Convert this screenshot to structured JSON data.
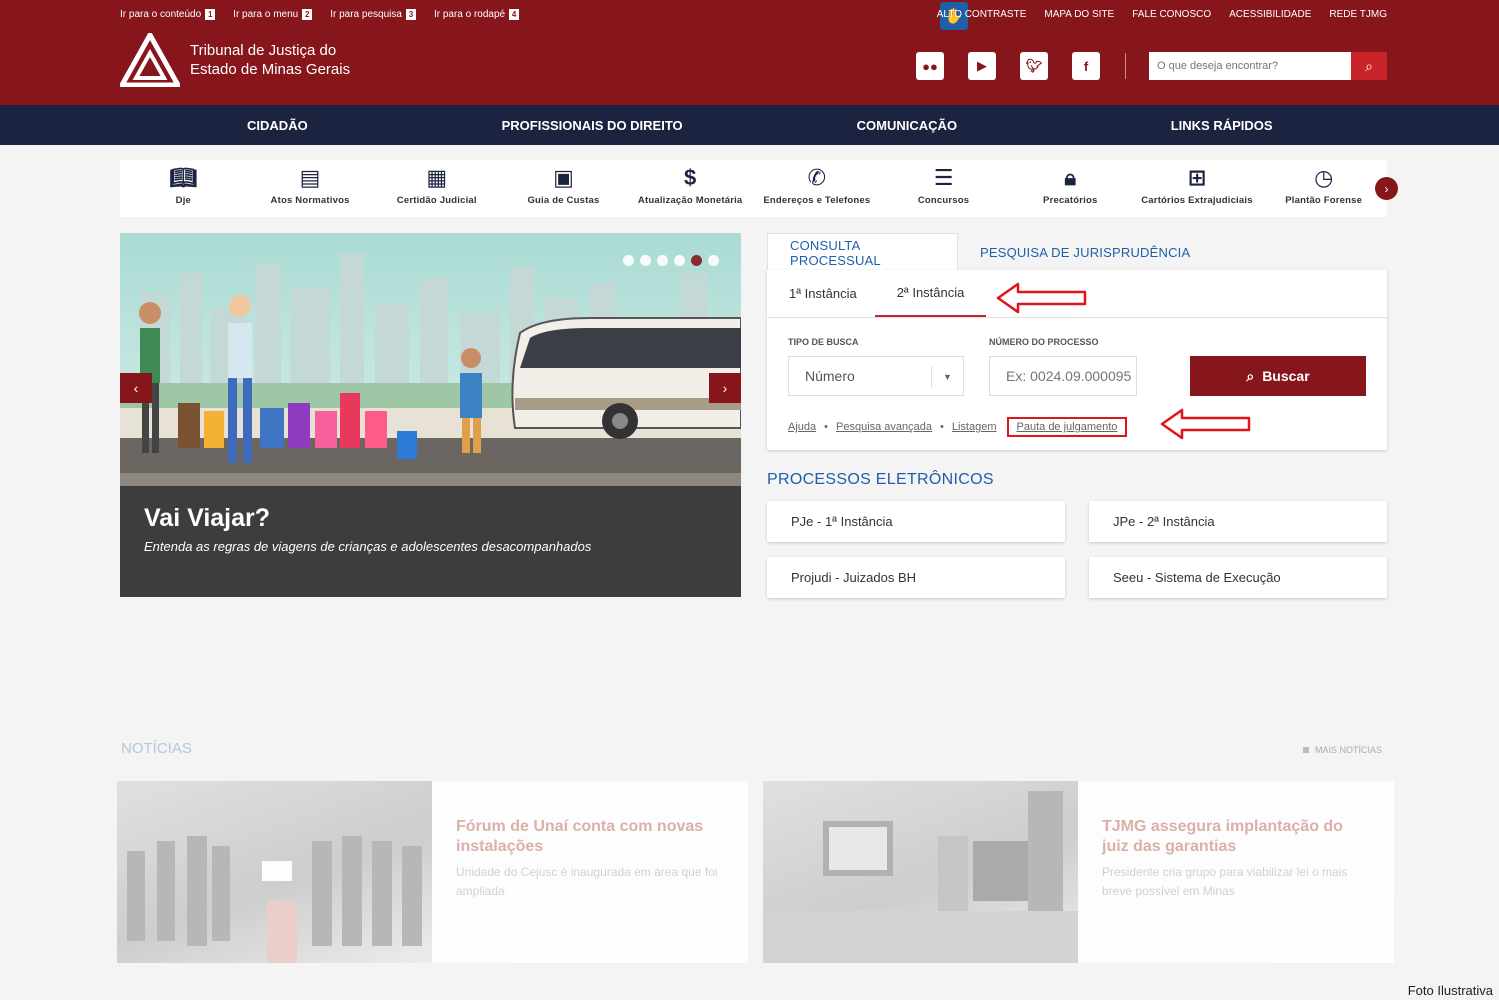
{
  "skip_links": [
    {
      "label": "Ir para o conteúdo",
      "key": "1"
    },
    {
      "label": "Ir para o menu",
      "key": "2"
    },
    {
      "label": "Ir para pesquisa",
      "key": "3"
    },
    {
      "label": "Ir para o rodapé",
      "key": "4"
    }
  ],
  "util_links": [
    "ALTO CONTRASTE",
    "MAPA DO SITE",
    "FALE CONOSCO",
    "ACESSIBILIDADE",
    "REDE TJMG"
  ],
  "logo": {
    "line1": "Tribunal de Justiça do",
    "line2": "Estado de Minas Gerais"
  },
  "social": [
    "flickr-icon",
    "youtube-icon",
    "twitter-icon",
    "facebook-icon"
  ],
  "search": {
    "placeholder": "O que deseja encontrar?"
  },
  "nav": [
    "CIDADÃO",
    "PROFISSIONAIS DO DIREITO",
    "COMUNICAÇÃO",
    "LINKS RÁPIDOS"
  ],
  "quick": [
    {
      "label": "Dje",
      "icon": "book-icon"
    },
    {
      "label": "Atos Normativos",
      "icon": "document-icon"
    },
    {
      "label": "Certidão Judicial",
      "icon": "certificate-icon"
    },
    {
      "label": "Guia de Custas",
      "icon": "dollar-document-icon"
    },
    {
      "label": "Atualização Monetária",
      "icon": "dollar-icon"
    },
    {
      "label": "Endereços e Telefones",
      "icon": "phone-icon"
    },
    {
      "label": "Concursos",
      "icon": "list-icon"
    },
    {
      "label": "Precatórios",
      "icon": "lock-dollar-icon"
    },
    {
      "label": "Cartórios Extrajudiciais",
      "icon": "building-icon"
    },
    {
      "label": "Plantão Forense",
      "icon": "clock-icon"
    }
  ],
  "carousel": {
    "title": "Vai Viajar?",
    "subtitle": "Entenda as regras de viagens de crianças e adolescentes desacompanhados",
    "dots": 6,
    "active_dot": 5
  },
  "consulta": {
    "tabs": [
      "CONSULTA PROCESSUAL",
      "PESQUISA DE JURISPRUDÊNCIA"
    ],
    "subtabs": [
      "1ª Instância",
      "2ª Instância"
    ],
    "tipo_label": "TIPO DE BUSCA",
    "tipo_value": "Número",
    "numero_label": "NÚMERO DO PROCESSO",
    "numero_placeholder": "Ex: 0024.09.000095",
    "buscar": "Buscar",
    "links": [
      "Ajuda",
      "Pesquisa avançada",
      "Listagem",
      "Pauta de julgamento"
    ]
  },
  "processos": {
    "title": "PROCESSOS ELETRÔNICOS",
    "items": [
      "PJe - 1ª Instância",
      "JPe - 2ª Instância",
      "Projudi - Juizados BH",
      "Seeu - Sistema de Execução"
    ]
  },
  "noticias": {
    "title": "NOTÍCIAS",
    "mais": "MAIS NOTÍCIAS",
    "items": [
      {
        "title": "Fórum de Unaí conta com novas instalações",
        "summary": "Unidade do Cejusc é inaugurada em área que foi ampliada"
      },
      {
        "title": "TJMG assegura implantação do juiz das garantias",
        "summary": "Presidente cria grupo para viabilizar lei o mais breve possível em Minas"
      }
    ]
  },
  "credit": "Foto Ilustrativa",
  "colors": {
    "brand": "#86161b",
    "nav": "#1b2340",
    "link_blue": "#1e5fa8",
    "annotation_red": "#e0141b"
  }
}
